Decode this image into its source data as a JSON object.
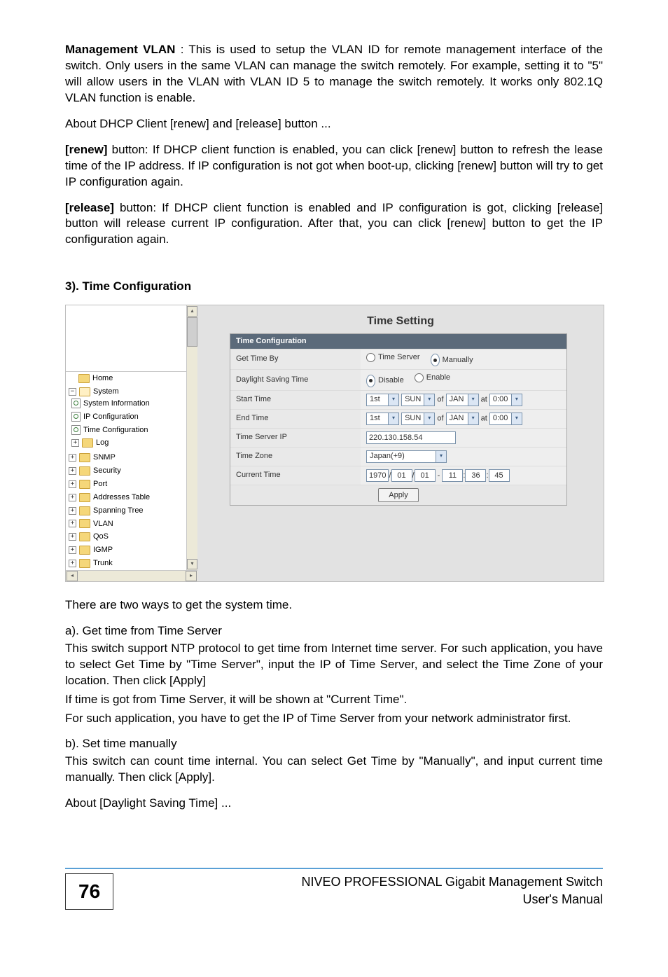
{
  "body": {
    "para1_label": "Management VLAN",
    "para1_rest": " : This is used to setup the VLAN ID for remote management interface of the switch.  Only users in the same VLAN can manage the switch remotely.   For example, setting it to \"5\" will allow users in the VLAN with VLAN ID 5 to manage the switch remotely.  It works only 802.1Q VLAN function is enable.",
    "para2": "About DHCP Client [renew] and [release] button ...",
    "para3_label": "[renew]",
    "para3_rest": " button: If DHCP client function is enabled, you can click [renew] button to refresh the lease time of the IP address.  If IP configuration is not got when boot-up, clicking [renew] button will try to get IP configuration again.",
    "para4_label": "[release]",
    "para4_rest": " button: If DHCP client function is enabled and IP configuration is got, clicking [release] button will release current IP configuration.  After that, you can click [renew] button to get the IP configuration again.",
    "heading3": "3). Time Configuration",
    "after1": "There are two ways to get the system time.",
    "after2": "a). Get time from Time Server",
    "after3": "This switch support NTP protocol to get time from Internet time server.  For such application, you have to select Get Time by \"Time Server\", input the IP of Time Server, and select the Time Zone of your location.  Then click [Apply]",
    "after4": "If time is got from Time Server, it will be shown at \"Current Time\".",
    "after5": "For such application, you have to get the IP of Time Server from your network administrator first.",
    "after6": "b). Set time manually",
    "after7": "This switch can count time internal.  You can select Get Time by \"Manually\", and input current time manually.   Then click [Apply].",
    "after8": "About [Daylight Saving Time] ..."
  },
  "tree": {
    "home": "Home",
    "system": "System",
    "sysinfo": "System Information",
    "ipconf": "IP Configuration",
    "timeconf": "Time Configuration",
    "log": "Log",
    "snmp": "SNMP",
    "security": "Security",
    "port": "Port",
    "addr": "Addresses Table",
    "stp": "Spanning Tree",
    "vlan": "VLAN",
    "qos": "QoS",
    "igmp": "IGMP",
    "trunk": "Trunk"
  },
  "ts": {
    "title": "Time Setting",
    "panel_header": "Time Configuration",
    "rows": {
      "get_time_by": "Get Time By",
      "dst": "Daylight Saving Time",
      "start": "Start Time",
      "end": "End Time",
      "tsip": "Time Server IP",
      "tz": "Time Zone",
      "cur": "Current Time"
    },
    "radio": {
      "time_server": "Time Server",
      "manually": "Manually",
      "disable": "Disable",
      "enable": "Enable"
    },
    "start_vals": {
      "ord": "1st",
      "day": "SUN",
      "of": "of",
      "mon": "JAN",
      "at": "at",
      "time": "0:00"
    },
    "end_vals": {
      "ord": "1st",
      "day": "SUN",
      "of": "of",
      "mon": "JAN",
      "at": "at",
      "time": "0:00"
    },
    "tsip_value": "220.130.158.54",
    "tz_value": "Japan(+9)",
    "cur_vals": {
      "y": "1970",
      "m": "01",
      "d": "01",
      "h": "11",
      "mi": "36",
      "s": "45",
      "slash": "/",
      "dash": "-",
      "colon": ":"
    },
    "apply": "Apply"
  },
  "footer": {
    "page": "76",
    "line1": "NIVEO PROFESSIONAL Gigabit Management Switch",
    "line2": "User's Manual"
  }
}
